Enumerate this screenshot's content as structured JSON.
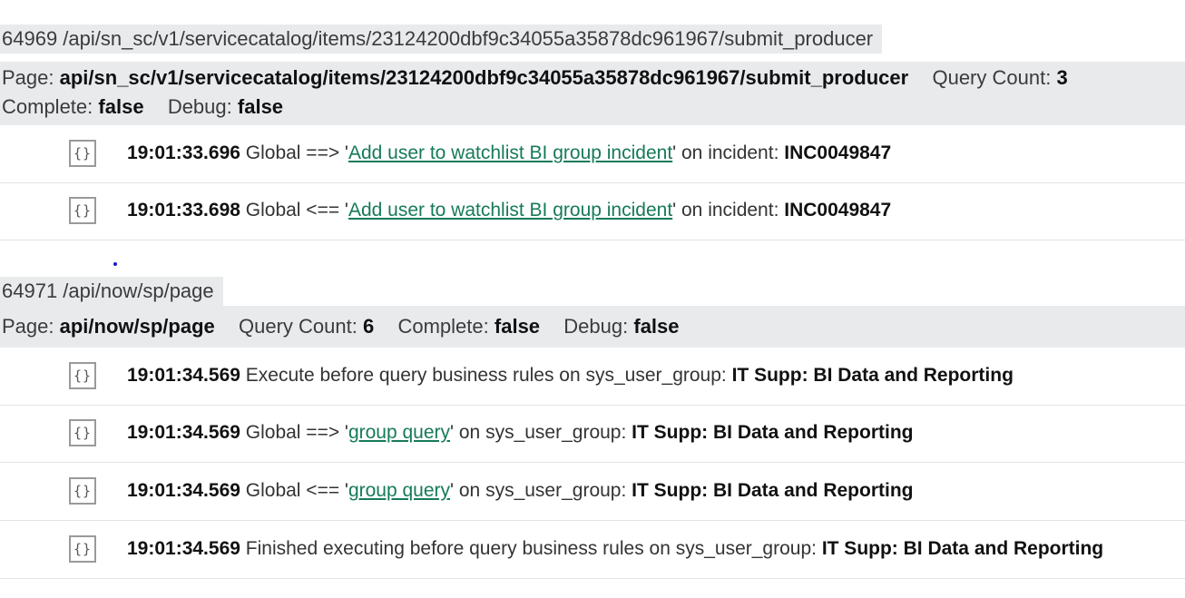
{
  "transactions": [
    {
      "title": "64969 /api/sn_sc/v1/servicecatalog/items/23124200dbf9c34055a35878dc961967/submit_producer",
      "meta": {
        "page_label": "Page:",
        "page_value": "api/sn_sc/v1/servicecatalog/items/23124200dbf9c34055a35878dc961967/submit_producer",
        "query_count_label": "Query Count:",
        "query_count_value": "3",
        "complete_label": "Complete:",
        "complete_value": "false",
        "debug_label": "Debug:",
        "debug_value": "false"
      },
      "logs": [
        {
          "json_icon": "{}",
          "time": "19:01:33.696",
          "prefix": " Global ==> '",
          "link": "Add user to watchlist BI group incident",
          "suffix": "' on incident: ",
          "record": "INC0049847"
        },
        {
          "json_icon": "{}",
          "time": "19:01:33.698",
          "prefix": " Global <== '",
          "link": "Add user to watchlist BI group incident",
          "suffix": "' on incident: ",
          "record": "INC0049847"
        }
      ]
    },
    {
      "title": "64971 /api/now/sp/page",
      "meta": {
        "page_label": "Page:",
        "page_value": "api/now/sp/page",
        "query_count_label": "Query Count:",
        "query_count_value": "6",
        "complete_label": "Complete:",
        "complete_value": "false",
        "debug_label": "Debug:",
        "debug_value": "false"
      },
      "logs": [
        {
          "json_icon": "{}",
          "time": "19:01:34.569",
          "text": " Execute before query business rules on sys_user_group: ",
          "record": "IT Supp: BI Data and Reporting"
        },
        {
          "json_icon": "{}",
          "time": "19:01:34.569",
          "prefix": " Global ==> '",
          "link": "group query",
          "suffix": "' on sys_user_group: ",
          "record": "IT Supp: BI Data and Reporting"
        },
        {
          "json_icon": "{}",
          "time": "19:01:34.569",
          "prefix": " Global <== '",
          "link": "group query",
          "suffix": "' on sys_user_group: ",
          "record": "IT Supp: BI Data and Reporting"
        },
        {
          "json_icon": "{}",
          "time": "19:01:34.569",
          "text": " Finished executing before query business rules on sys_user_group: ",
          "record": "IT Supp: BI Data and Reporting"
        }
      ]
    }
  ],
  "colors": {
    "header_bg": "#e8eaec",
    "link": "#167a5a",
    "row_divider": "#e3e3e3"
  }
}
